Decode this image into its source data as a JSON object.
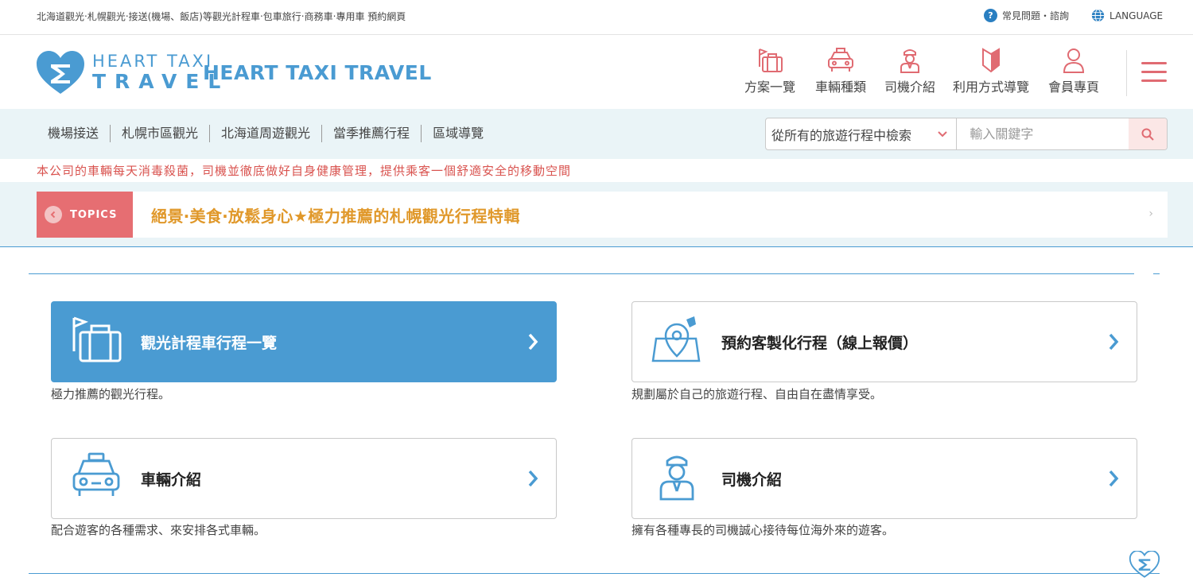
{
  "topbar": {
    "tagline": "北海道觀光‧札幌觀光‧接送(機場、飯店)等觀光計程車‧包車旅行‧商務車‧專用車 預約網頁",
    "faq": "常見問題・諮詢",
    "language": "LANGUAGE"
  },
  "header": {
    "logo_line1": "HEART TAXI",
    "logo_line2": "TRAVEL",
    "brand": "HEART TAXI TRAVEL",
    "nav": [
      {
        "label": "方案一覽",
        "icon": "suitcase-flag-icon"
      },
      {
        "label": "車輛種類",
        "icon": "taxi-icon"
      },
      {
        "label": "司機介紹",
        "icon": "driver-icon"
      },
      {
        "label": "利用方式導覽",
        "icon": "beginner-mark-icon"
      },
      {
        "label": "會員專頁",
        "icon": "user-icon"
      }
    ]
  },
  "subnav": {
    "links": [
      "機場接送",
      "札幌市區觀光",
      "北海道周遊觀光",
      "當季推薦行程",
      "區域導覽"
    ],
    "search_select": "從所有的旅遊行程中檢索",
    "search_placeholder": "輸入關鍵字"
  },
  "notice": "本公司的車輛每天消毒殺菌，司機並徹底做好自身健康管理，提供乘客一個舒適安全的移動空間",
  "topics": {
    "badge": "TOPICS",
    "headline": "絕景‧美食‧放鬆身心★極力推薦的札幌觀光行程特輯"
  },
  "cards": [
    {
      "title": "觀光計程車行程一覽",
      "desc": "極力推薦的觀光行程。",
      "icon": "suitcase-flag-icon"
    },
    {
      "title": "預約客製化行程（線上報價）",
      "desc": "規劃屬於自己的旅遊行程、自由自在盡情享受。",
      "icon": "map-pin-icon"
    },
    {
      "title": "車輛介紹",
      "desc": "配合遊客的各種需求、來安排各式車輛。",
      "icon": "taxi-icon"
    },
    {
      "title": "司機介紹",
      "desc": "擁有各種專長的司機誠心接待每位海外來的遊客。",
      "icon": "driver-icon"
    }
  ],
  "colors": {
    "accent_blue": "#4a9bd2",
    "accent_red": "#e06b72",
    "topics_text": "#e0982a",
    "notice": "#d9534f"
  }
}
